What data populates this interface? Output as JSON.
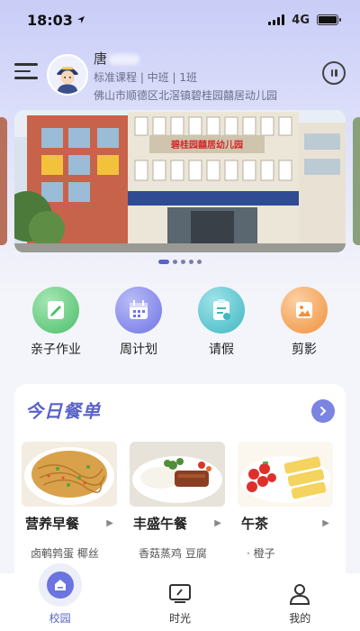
{
  "status": {
    "time": "18:03",
    "network": "4G"
  },
  "user": {
    "name": "唐",
    "meta": "标准课程 | 中班 | 1班",
    "address": "佛山市顺德区北滘镇碧桂园囍居动儿园"
  },
  "banner": {
    "school_sign": "碧桂园囍居幼儿园",
    "slide_count": 5,
    "active_slide": 1
  },
  "quick_actions": [
    {
      "label": "亲子作业",
      "icon": "homework-icon",
      "color": "#4cbf6a"
    },
    {
      "label": "周计划",
      "icon": "calendar-icon",
      "color": "#6f74e6"
    },
    {
      "label": "请假",
      "icon": "leave-form-icon",
      "color": "#3fb7c2"
    },
    {
      "label": "剪影",
      "icon": "photo-icon",
      "color": "#f0913c"
    }
  ],
  "menu": {
    "title": "今日餐单",
    "meals": [
      {
        "name": "营养早餐",
        "dish": "卤鹌鹑蛋 椰丝",
        "image": "noodles-photo"
      },
      {
        "name": "丰盛午餐",
        "dish": "香菇蒸鸡 豆腐",
        "image": "meat-rice-photo"
      },
      {
        "name": "午茶",
        "dish": "· 橙子",
        "image": "fruit-photo"
      }
    ]
  },
  "tabbar": [
    {
      "label": "校园",
      "active": true
    },
    {
      "label": "时光",
      "active": false
    },
    {
      "label": "我的",
      "active": false
    }
  ],
  "colors": {
    "accent": "#5a63c8",
    "header_gradient_top": "#c9cdf7"
  }
}
